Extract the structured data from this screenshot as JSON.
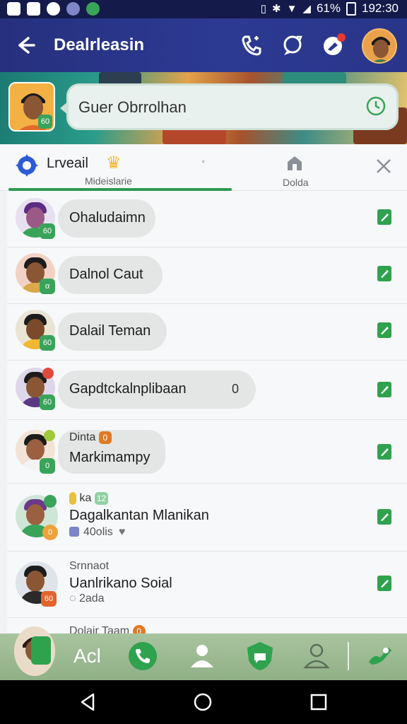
{
  "status_bar": {
    "battery_percent": "61%",
    "time": "192:30"
  },
  "header": {
    "title": "Dealrleasin"
  },
  "banner": {
    "search_text": "Guer Obrrolhan"
  },
  "tabs": {
    "primary_label": "Lrveail",
    "primary_sub": "Mideislarie",
    "secondary_label": "Dolda",
    "small_mark": "ﾟ"
  },
  "chats": [
    {
      "name": "Ohaludaimn",
      "badge": "60",
      "badge_color": "#3aa35a",
      "shirt": "#6b2f8a",
      "skin": "#9b5a86"
    },
    {
      "name": "Dalnol Caut",
      "badge": "α",
      "badge_color": "#3aa35a",
      "shirt": "#d8a84a",
      "skin": "#8a5634"
    },
    {
      "name": "Dalail Teman",
      "badge": "60",
      "badge_color": "#3aa35a",
      "shirt": "#f0b731",
      "skin": "#7a4a2a"
    },
    {
      "name": "Gapdtckalnplibaan",
      "count": "0",
      "badge": "60",
      "badge_color": "#3aa35a",
      "shirt": "#5a3a84",
      "skin": "#8a5634"
    },
    {
      "label": "Dinta",
      "label_badge": "0",
      "label_badge_color": "#e07a24",
      "name": "Markimampy",
      "badge": "0",
      "badge_color": "#3aa35a",
      "shirt": "#f3f3f3",
      "skin": "#9a6040"
    },
    {
      "label": "ka",
      "label_badge": "12",
      "label_badge_color": "#8fd0a2",
      "name": "Dagalkantan Mlanikan",
      "sub": "40olis",
      "badge": "0",
      "badge_color": "#f0a23a",
      "shirt": "#3aa35a",
      "skin": "#9a6040"
    },
    {
      "label": "Srnnaot",
      "name": "Uanlrikano Soial",
      "sub": "2ada",
      "badge": "60",
      "badge_color": "#e4632c",
      "shirt": "#2a2a2a",
      "skin": "#8a5634"
    },
    {
      "label": "Dolair Taam",
      "label_badge": "0",
      "label_badge_color": "#e07a24",
      "shirt": "#3aa35a",
      "skin": "#8a5634"
    }
  ],
  "action_bar": {
    "add_label": "Acl"
  },
  "colors": {
    "app_bar": "#2c3a92",
    "accent_green": "#2e9a4f"
  },
  "icons": [
    "arrow-left-icon",
    "phone-icon",
    "chat-sync-icon",
    "chat-badge-icon",
    "clock-icon",
    "gear-icon",
    "crown-icon",
    "home-icon",
    "close-icon",
    "edit-icon",
    "phone-call-icon",
    "person-icon",
    "shield-chat-icon",
    "person-outline-icon",
    "wave-icon",
    "back-nav-icon",
    "home-nav-icon",
    "recents-nav-icon"
  ]
}
